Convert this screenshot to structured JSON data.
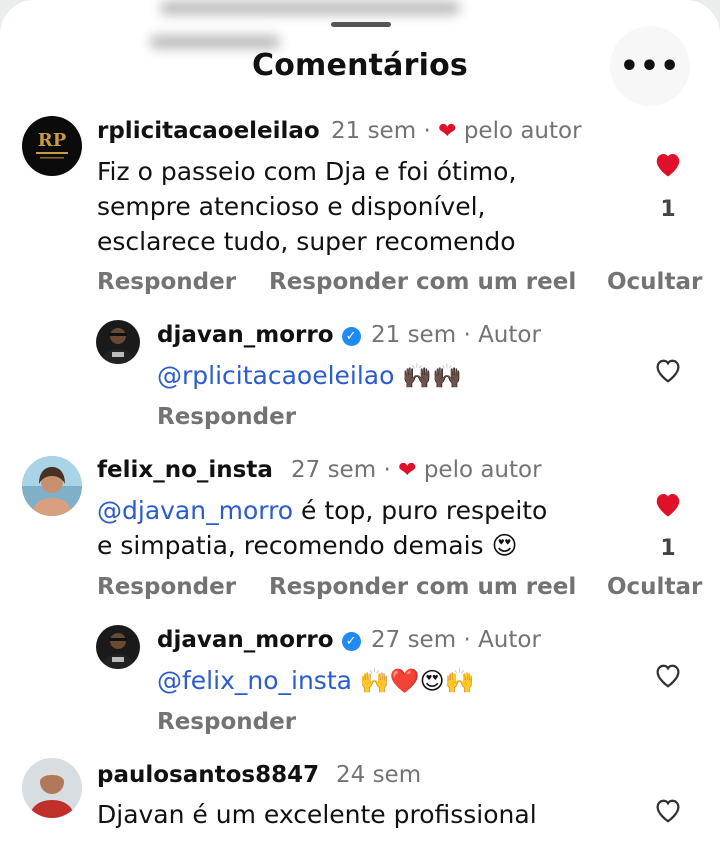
{
  "sheet": {
    "title": "Comentários",
    "menu_icon": "more-horizontal-icon"
  },
  "comments": [
    {
      "username": "rplicitacaoeleilao",
      "time": "21 sem",
      "separator": "·",
      "liked_by_author": "pelo autor",
      "text_lines": [
        "Fiz o passeio com Dja e foi ótimo,",
        "sempre atencioso e disponível,",
        "esclarece tudo, super recomendo"
      ],
      "like_count": "1",
      "liked": true,
      "actions": [
        "Responder",
        "Responder com um reel",
        "Ocultar"
      ],
      "avatar_text": "RP",
      "reply": {
        "username": "djavan_morro",
        "time": "21 sem",
        "separator": "·",
        "author_badge": "Autor",
        "mention": "@rplicitacaoeleilao",
        "emoji": "🙌🏿🙌🏿",
        "action": "Responder",
        "liked": false
      }
    },
    {
      "username": "felix_no_insta",
      "time": "27 sem",
      "separator": "·",
      "liked_by_author": "pelo autor",
      "mention": "@djavan_morro",
      "text_line1_rest": " é top,  puro respeito",
      "text_line2": "e simpatia,  recomendo demais 😍",
      "like_count": "1",
      "liked": true,
      "actions": [
        "Responder",
        "Responder com um reel",
        "Ocultar"
      ],
      "reply": {
        "username": "djavan_morro",
        "time": "27 sem",
        "separator": "·",
        "author_badge": "Autor",
        "mention": "@felix_no_insta",
        "emoji": "🙌❤️😍🙌",
        "action": "Responder",
        "liked": false
      }
    },
    {
      "username": "paulosantos8847",
      "time": "24 sem",
      "text_line1": "Djavan é um excelente profissional",
      "liked": false
    }
  ],
  "colors": {
    "heart_red": "#e0102a",
    "mention_blue": "#2b5ccf",
    "meta_gray": "#737373",
    "verified_blue": "#1f8bf0"
  }
}
